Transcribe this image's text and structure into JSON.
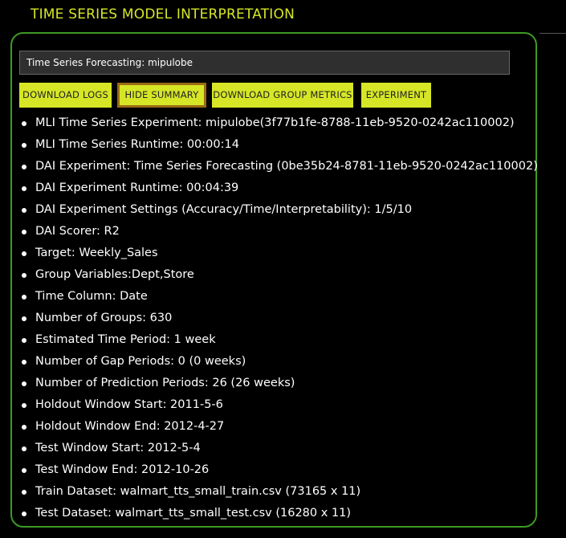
{
  "page": {
    "title": "TIME SERIES MODEL INTERPRETATION"
  },
  "experiment_field": {
    "value": "Time Series Forecasting: mipulobe"
  },
  "toolbar": {
    "download_logs": "DOWNLOAD LOGS",
    "hide_summary": "HIDE SUMMARY",
    "download_group_metrics": "DOWNLOAD GROUP METRICS",
    "experiment": "EXPERIMENT"
  },
  "summary": {
    "items": [
      "MLI Time Series Experiment: mipulobe(3f77b1fe-8788-11eb-9520-0242ac110002)",
      "MLI Time Series Runtime: 00:00:14",
      "DAI Experiment: Time Series Forecasting (0be35b24-8781-11eb-9520-0242ac110002)",
      "DAI Experiment Runtime: 00:04:39",
      "DAI Experiment Settings (Accuracy/Time/Interpretability): 1/5/10",
      "DAI Scorer: R2",
      "Target: Weekly_Sales",
      "Group Variables:Dept,Store",
      "Time Column: Date",
      "Number of Groups: 630",
      "Estimated Time Period: 1 week",
      "Number of Gap Periods: 0 (0 weeks)",
      "Number of Prediction Periods: 26 (26 weeks)",
      "Holdout Window Start: 2011-5-6",
      "Holdout Window End: 2012-4-27",
      "Test Window Start: 2012-5-4",
      "Test Window End: 2012-10-26",
      "Train Dataset: walmart_tts_small_train.csv (73165 x 11)",
      "Test Dataset: walmart_tts_small_test.csv (16280 x 11)"
    ]
  },
  "colors": {
    "accent": "#d6e626",
    "panel_border": "#3d9a24",
    "active_button_border": "#9a6b15",
    "background": "#000000"
  }
}
